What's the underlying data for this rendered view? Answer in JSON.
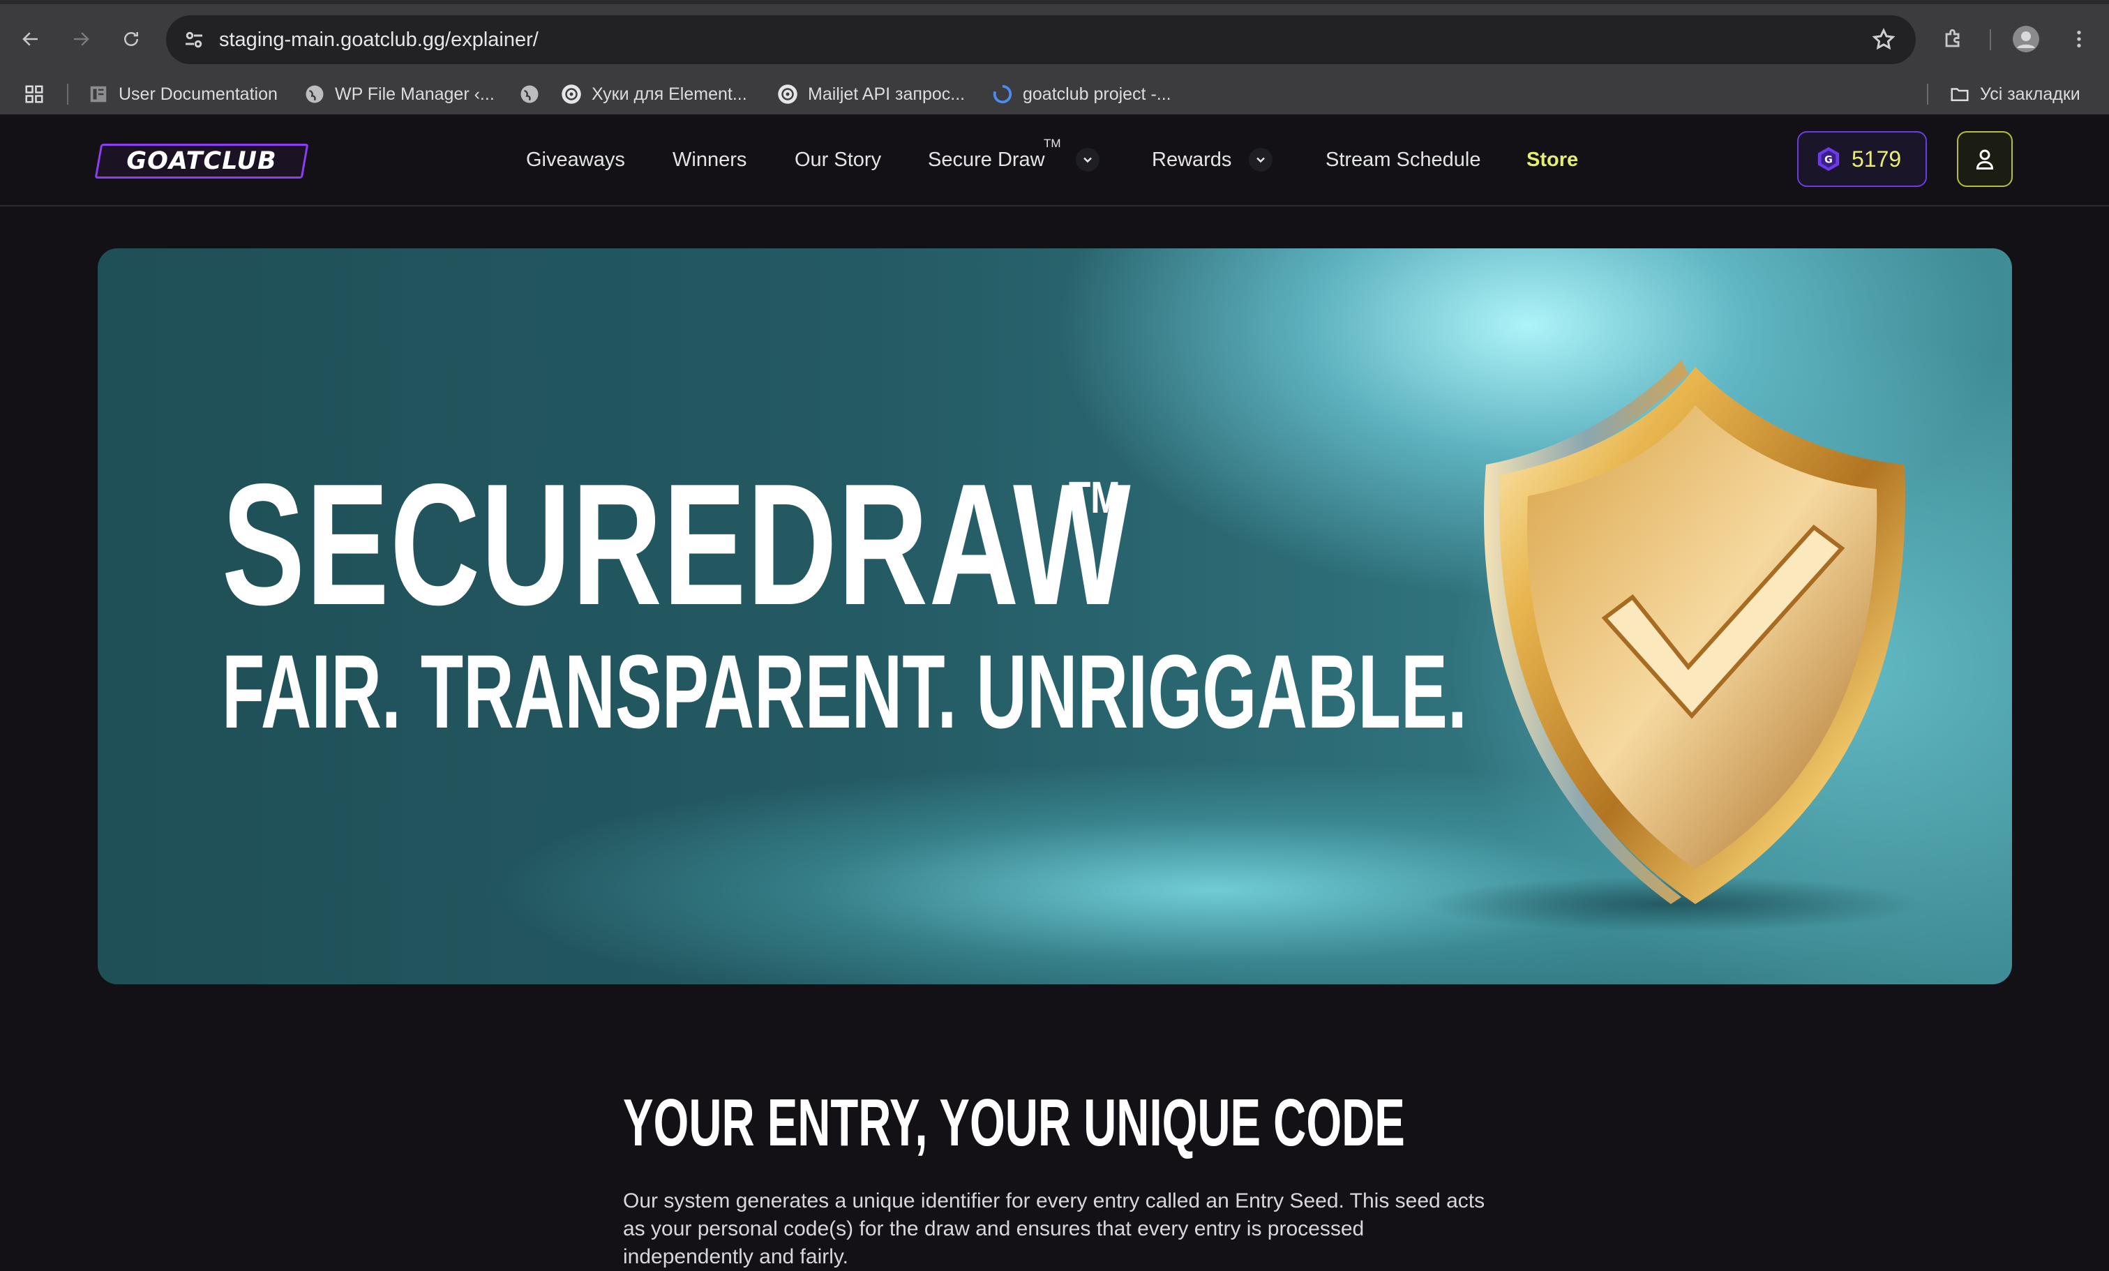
{
  "browser": {
    "url": "staging-main.goatclub.gg/explainer/",
    "bookmarks": [
      {
        "label": "User Documentation",
        "icon": "docs-icon"
      },
      {
        "label": "WP File Manager ‹...",
        "icon": "globe-icon"
      },
      {
        "label": "",
        "icon": "globe-icon"
      },
      {
        "label": "Хуки для Element...",
        "icon": "openai-icon"
      },
      {
        "label": "Mailjet API запрос...",
        "icon": "openai-icon"
      },
      {
        "label": "goatclub project -...",
        "icon": "loader-icon"
      }
    ],
    "all_bookmarks_label": "Усі закладки"
  },
  "site": {
    "logo_text": "GOATCLUB",
    "nav": {
      "giveaways": "Giveaways",
      "winners": "Winners",
      "our_story": "Our Story",
      "secure_draw": "Secure Draw",
      "secure_draw_tm": "TM",
      "rewards": "Rewards",
      "stream_schedule": "Stream Schedule",
      "store": "Store"
    },
    "points": "5179",
    "accent_purple": "#6c3be6",
    "accent_yellow": "#e6ee6c"
  },
  "hero": {
    "title": "SECUREDRAW",
    "tm": "TM",
    "subtitle": "FAIR. TRANSPARENT. UNRIGGABLE."
  },
  "section": {
    "title": "YOUR ENTRY, YOUR UNIQUE CODE",
    "body": "Our system generates a unique identifier for every entry called an Entry Seed. This seed acts as your personal code(s) for the draw and ensures that every entry is processed independently and fairly."
  }
}
